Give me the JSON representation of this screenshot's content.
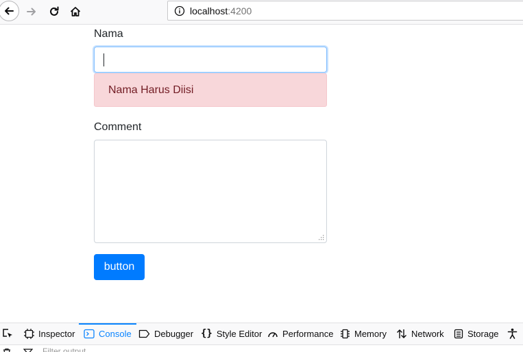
{
  "browser": {
    "url_host": "localhost",
    "url_port": ":4200"
  },
  "form": {
    "name_label": "Nama",
    "name_value": "",
    "error_message": "Nama Harus Diisi",
    "comment_label": "Comment",
    "comment_value": "",
    "button_label": "button"
  },
  "devtools": {
    "tabs": [
      {
        "label": "Inspector",
        "icon": "inspector-icon"
      },
      {
        "label": "Console",
        "icon": "console-icon",
        "active": true
      },
      {
        "label": "Debugger",
        "icon": "debugger-icon"
      },
      {
        "label": "Style Editor",
        "icon": "style-editor-icon"
      },
      {
        "label": "Performance",
        "icon": "performance-icon"
      },
      {
        "label": "Memory",
        "icon": "memory-icon"
      },
      {
        "label": "Network",
        "icon": "network-icon"
      },
      {
        "label": "Storage",
        "icon": "storage-icon"
      },
      {
        "label": "",
        "icon": "accessibility-icon"
      }
    ],
    "filter_placeholder": "Filter output"
  },
  "colors": {
    "primary": "#007bff",
    "alert_bg": "#f8d7da",
    "alert_text": "#721c24",
    "devtools_active": "#0a84ff"
  }
}
